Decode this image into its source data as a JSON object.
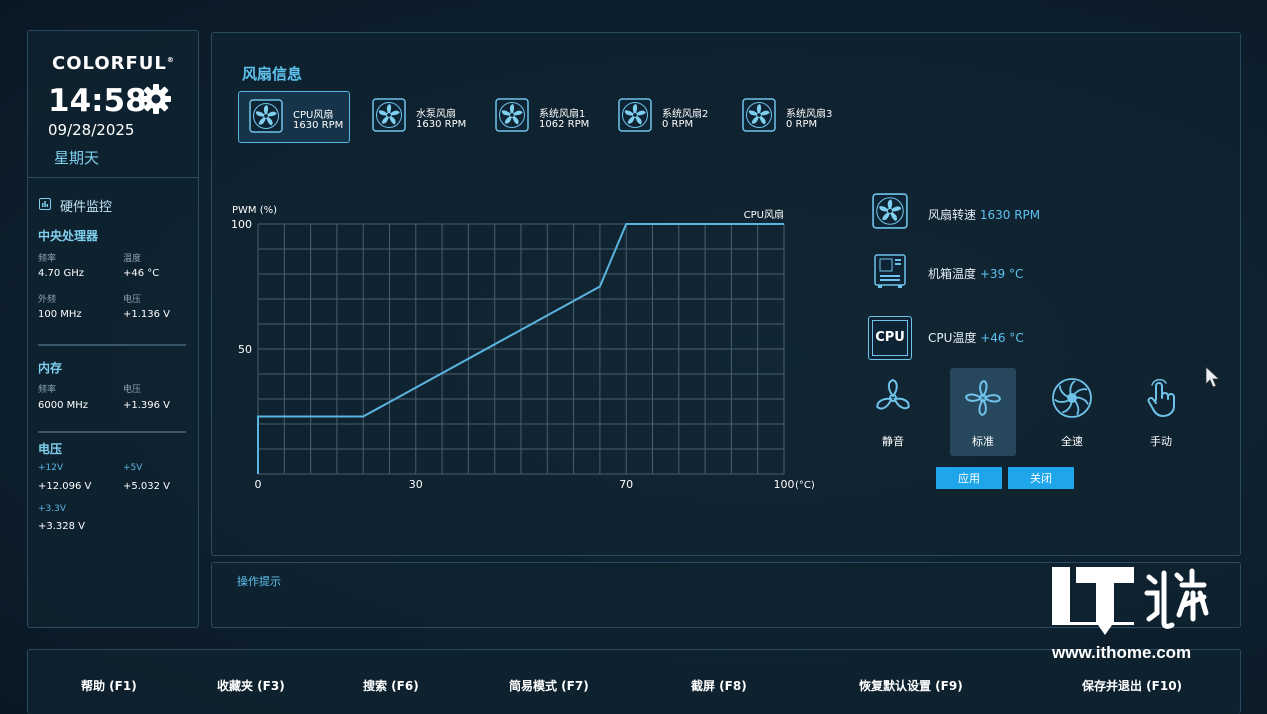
{
  "brand": {
    "name": "COLORFUL",
    "mark": "®"
  },
  "clock": {
    "time": "14:58",
    "date": "09/28/2025",
    "weekday": "星期天"
  },
  "hardware_monitor": {
    "title": "硬件监控",
    "cpu": {
      "title": "中央处理器",
      "freq_label": "频率",
      "freq": "4.70 GHz",
      "temp_label": "温度",
      "temp": "+46 °C",
      "bclk_label": "外频",
      "bclk": "100 MHz",
      "volt_label": "电压",
      "volt": "+1.136 V"
    },
    "memory": {
      "title": "内存",
      "freq_label": "频率",
      "freq": "6000 MHz",
      "volt_label": "电压",
      "volt": "+1.396 V"
    },
    "voltage": {
      "title": "电压",
      "v12_label": "+12V",
      "v12": "+12.096 V",
      "v5_label": "+5V",
      "v5": "+5.032 V",
      "v33_label": "+3.3V",
      "v33": "+3.328 V"
    }
  },
  "fan_info": {
    "title": "风扇信息",
    "fans": [
      {
        "name": "CPU风扇",
        "rpm": "1630 RPM"
      },
      {
        "name": "水泵风扇",
        "rpm": "1630 RPM"
      },
      {
        "name": "系统风扇1",
        "rpm": "1062 RPM"
      },
      {
        "name": "系统风扇2",
        "rpm": "0 RPM"
      },
      {
        "name": "系统风扇3",
        "rpm": "0 RPM"
      }
    ]
  },
  "chart_data": {
    "type": "line",
    "ylabel": "PWM (%)",
    "xlabel": "(°C)",
    "series": [
      {
        "name": "CPU风扇",
        "x": [
          0,
          0,
          20,
          65,
          70,
          100
        ],
        "y": [
          0,
          23,
          23,
          75,
          100,
          100
        ]
      }
    ],
    "xlim": [
      0,
      100
    ],
    "ylim": [
      0,
      100
    ],
    "xticks": [
      0,
      30,
      70,
      100
    ],
    "yticks": [
      50,
      100
    ],
    "grid": true,
    "grid_cols": 20,
    "grid_rows": 10,
    "color": "#5ab4e0"
  },
  "stats": {
    "fan_speed_label": "风扇转速",
    "fan_speed": "1630 RPM",
    "case_temp_label": "机箱温度",
    "case_temp": "+39 °C",
    "cpu_temp_label": "CPU温度",
    "cpu_temp": "+46 °C",
    "cpu_chip_text": "CPU"
  },
  "modes": [
    {
      "label": "静音",
      "icon": "fan-three-blade-icon"
    },
    {
      "label": "标准",
      "icon": "fan-four-blade-icon",
      "selected": true
    },
    {
      "label": "全速",
      "icon": "fan-many-blade-icon"
    },
    {
      "label": "手动",
      "icon": "hand-pointer-icon"
    }
  ],
  "buttons": {
    "apply": "应用",
    "close": "关闭"
  },
  "hint": {
    "title": "操作提示"
  },
  "function_keys": [
    {
      "label": "帮助 (F1)"
    },
    {
      "label": "收藏夹 (F3)"
    },
    {
      "label": "搜索 (F6)"
    },
    {
      "label": "简易模式 (F7)"
    },
    {
      "label": "截屏 (F8)"
    },
    {
      "label": "恢复默认设置 (F9)"
    },
    {
      "label": "保存并退出 (F10)"
    }
  ],
  "watermark": {
    "logo_text": "IT之家",
    "url": "www.ithome.com"
  },
  "colors": {
    "accent": "#5ec2ef",
    "button": "#1fa6ea",
    "panel_border": "#2a4a60"
  }
}
